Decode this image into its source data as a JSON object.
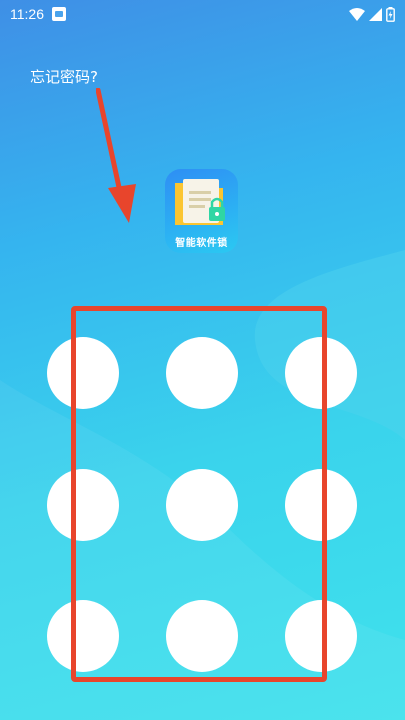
{
  "status_bar": {
    "time": "11:26",
    "icons": [
      "app-notification-icon",
      "wifi-icon",
      "signal-icon",
      "battery-charging-icon"
    ]
  },
  "forgot_password_label": "忘记密码?",
  "app": {
    "label": "智能软件锁",
    "icon": "folder-lock-icon"
  },
  "pattern_lock": {
    "rows": 3,
    "cols": 3,
    "dots": [
      1,
      2,
      3,
      4,
      5,
      6,
      7,
      8,
      9
    ]
  },
  "annotations": {
    "arrow_color": "#e8452c",
    "box_color": "#e8452c"
  },
  "colors": {
    "bg_top": "#3f8fe6",
    "bg_bottom": "#40e2ec",
    "accent": "#e8452c"
  }
}
